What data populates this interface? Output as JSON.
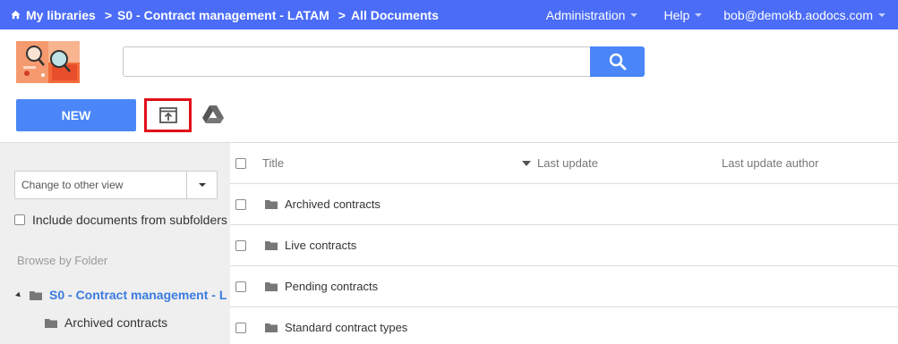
{
  "topbar": {
    "breadcrumbs": [
      "My libraries",
      "S0 - Contract management - LATAM",
      "All Documents"
    ],
    "separator": ">",
    "menus": {
      "administration": "Administration",
      "help": "Help",
      "user": "bob@demokb.aodocs.com"
    }
  },
  "search": {
    "value": "",
    "placeholder": ""
  },
  "toolbar": {
    "new_label": "NEW"
  },
  "sidebar": {
    "view_select_placeholder": "Change to other view",
    "include_subfolders_label": "Include documents from subfolders",
    "browse_label": "Browse by Folder",
    "tree_root": "S0 - Contract management - L",
    "tree_child": "Archived contracts"
  },
  "table": {
    "columns": [
      "Title",
      "Last update",
      "Last update author"
    ],
    "rows": [
      {
        "name": "Archived contracts"
      },
      {
        "name": "Live contracts"
      },
      {
        "name": "Pending contracts"
      },
      {
        "name": "Standard contract types"
      }
    ]
  },
  "colors": {
    "topbar": "#4a6cf7",
    "primary_button": "#4a86f7",
    "highlight_box": "#e0101a",
    "tree_link": "#3a7be0"
  },
  "icons": [
    "home-icon",
    "search-icon",
    "upload-icon",
    "google-drive-icon",
    "folder-icon",
    "caret-down-icon",
    "sort-desc-icon"
  ]
}
